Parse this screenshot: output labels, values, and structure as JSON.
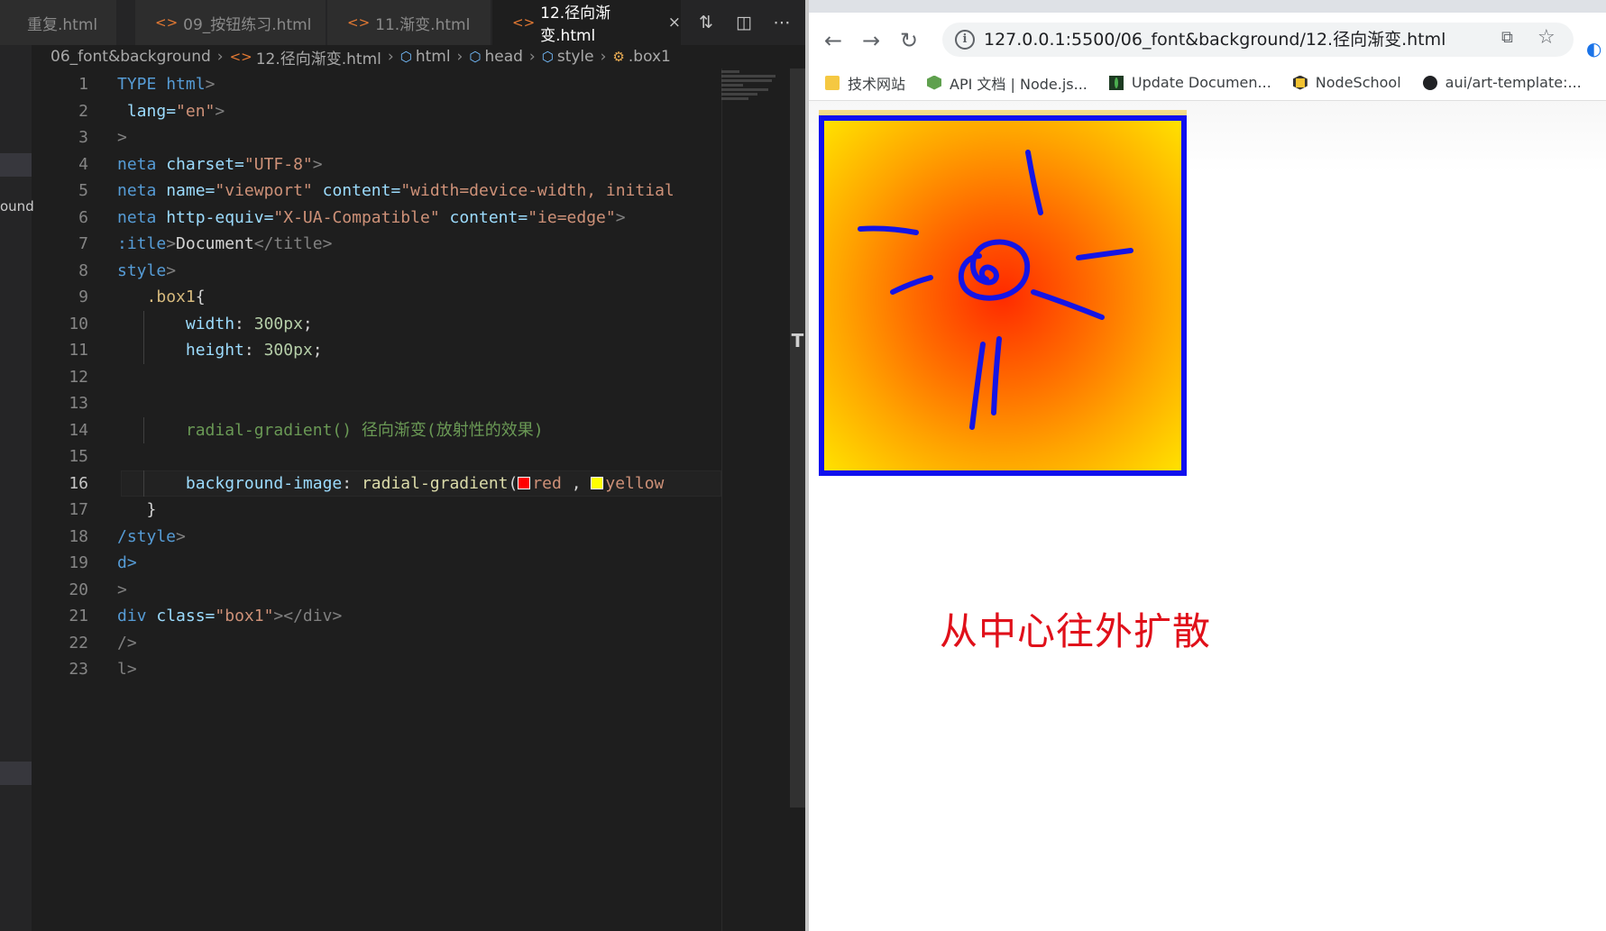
{
  "editor": {
    "tabs": [
      {
        "label": "重复.html",
        "active": false
      },
      {
        "label": "09_按钮练习.html",
        "active": false
      },
      {
        "label": "11.渐变.html",
        "active": false
      },
      {
        "label": "12.径向渐变.html",
        "active": true
      }
    ],
    "tab_close_glyph": "×",
    "actions": {
      "compare_icon": "git-compare-icon",
      "split_icon": "split-editor-icon",
      "more_icon": "more-actions-icon"
    },
    "breadcrumb": [
      "06_font&background",
      "12.径向渐变.html",
      "html",
      "head",
      "style",
      ".box1"
    ],
    "explorer_strip_label": "ound",
    "scrollbar_glyph": "T",
    "line_numbers": [
      "1",
      "2",
      "3",
      "4",
      "5",
      "6",
      "7",
      "8",
      "9",
      "10",
      "11",
      "12",
      "13",
      "14",
      "15",
      "16",
      "17",
      "18",
      "19",
      "20",
      "21",
      "22",
      "23"
    ],
    "current_line": 16,
    "code": {
      "l1": {
        "a": "TYPE",
        "b": "html",
        "c": ">"
      },
      "l2": {
        "a": "lang=",
        "b": "\"en\"",
        "c": ">"
      },
      "l3": ">",
      "l4": {
        "a": "neta",
        "b": "charset=",
        "c": "\"UTF-8\"",
        "d": ">"
      },
      "l5": {
        "a": "neta",
        "b": "name=",
        "c": "\"viewport\"",
        "d": "content=",
        "e": "\"width=device-width, initial"
      },
      "l6": {
        "a": "neta",
        "b": "http-equiv=",
        "c": "\"X-UA-Compatible\"",
        "d": "content=",
        "e": "\"ie=edge\"",
        "f": ">"
      },
      "l7": {
        "a": ":itle",
        "b": ">",
        "c": "Document",
        "d": "</title>"
      },
      "l8": {
        "a": "style",
        "b": ">"
      },
      "l9": {
        "a": ".box1",
        "b": "{"
      },
      "l10": {
        "a": "width",
        "b": ": ",
        "c": "300px",
        "d": ";"
      },
      "l11": {
        "a": "height",
        "b": ": ",
        "c": "300px",
        "d": ";"
      },
      "l14": "radial-gradient() 径向渐变(放射性的效果)",
      "l16": {
        "a": "background-image",
        "b": ": ",
        "c": "radial-gradient",
        "d": "(",
        "e": "red",
        "f": " , ",
        "g": "yellow"
      },
      "l17": "}",
      "l18": {
        "a": "/style",
        "b": ">"
      },
      "l19": "d>",
      "l20": ">",
      "l21": {
        "a": "div",
        "b": "class=",
        "c": "\"box1\"",
        "d": "></div>"
      },
      "l22": "/>",
      "l23": "l>"
    },
    "swatch_colors": {
      "red": "#ff0000",
      "yellow": "#ffff00"
    }
  },
  "browser": {
    "nav": {
      "back_icon": "back-arrow-icon",
      "forward_icon": "forward-arrow-icon",
      "reload_icon": "reload-icon"
    },
    "url": "127.0.0.1:5500/06_font&background/12.径向渐变.html",
    "bookmarks": [
      {
        "label": "技术网站",
        "icon": "folder-icon"
      },
      {
        "label": "API 文档 | Node.js...",
        "icon": "nodejs-icon"
      },
      {
        "label": "Update Documen...",
        "icon": "mongodb-icon"
      },
      {
        "label": "NodeSchool",
        "icon": "nodeschool-icon"
      },
      {
        "label": "aui/art-template:...",
        "icon": "github-icon"
      }
    ],
    "box_gradient_colors": {
      "center": "#ff2a00",
      "edge": "#ffe200",
      "border": "#1010ee"
    },
    "annotation": "从中心往外扩散"
  }
}
